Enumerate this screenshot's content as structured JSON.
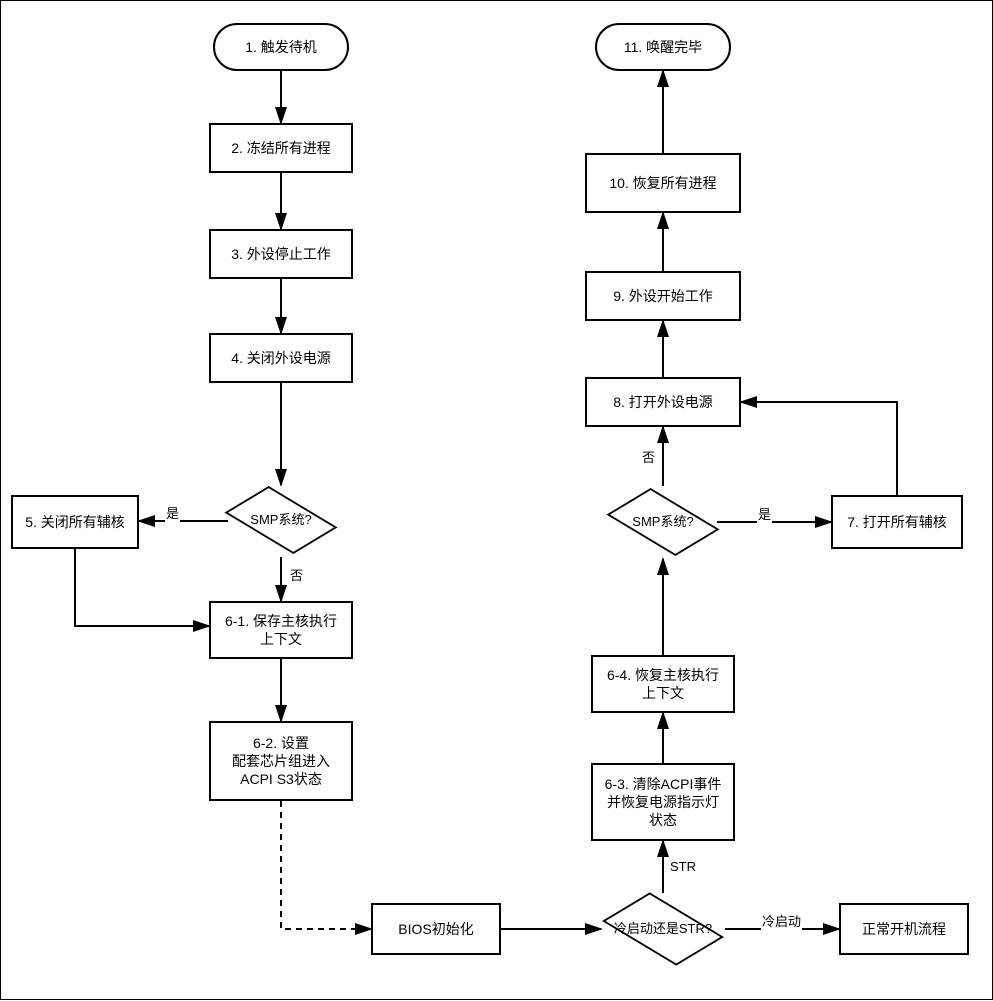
{
  "chart_data": {
    "type": "flowchart",
    "title": "",
    "nodes": [
      {
        "id": "n1",
        "label": "1. 触发待机",
        "shape": "terminator"
      },
      {
        "id": "n2",
        "label": "2. 冻结所有进程",
        "shape": "process"
      },
      {
        "id": "n3",
        "label": "3. 外设停止工作",
        "shape": "process"
      },
      {
        "id": "n4",
        "label": "4. 关闭外设电源",
        "shape": "process"
      },
      {
        "id": "d1",
        "label": "SMP系统?",
        "shape": "decision"
      },
      {
        "id": "n5",
        "label": "5. 关闭所有辅核",
        "shape": "process"
      },
      {
        "id": "n61",
        "label": "6-1. 保存主核执行上下文",
        "shape": "process"
      },
      {
        "id": "n62",
        "label": "6-2. 设置配套芯片组进入ACPI S3状态",
        "shape": "process"
      },
      {
        "id": "bios",
        "label": "BIOS初始化",
        "shape": "process"
      },
      {
        "id": "d2",
        "label": "冷启动还是STR?",
        "shape": "decision"
      },
      {
        "id": "nboot",
        "label": "正常开机流程",
        "shape": "process"
      },
      {
        "id": "n63",
        "label": "6-3. 清除ACPI事件并恢复电源指示灯状态",
        "shape": "process"
      },
      {
        "id": "n64",
        "label": "6-4. 恢复主核执行上下文",
        "shape": "process"
      },
      {
        "id": "d3",
        "label": "SMP系统?",
        "shape": "decision"
      },
      {
        "id": "n7",
        "label": "7. 打开所有辅核",
        "shape": "process"
      },
      {
        "id": "n8",
        "label": "8. 打开外设电源",
        "shape": "process"
      },
      {
        "id": "n9",
        "label": "9. 外设开始工作",
        "shape": "process"
      },
      {
        "id": "n10",
        "label": "10. 恢复所有进程",
        "shape": "process"
      },
      {
        "id": "n11",
        "label": "11. 唤醒完毕",
        "shape": "terminator"
      }
    ],
    "edges": [
      {
        "from": "n1",
        "to": "n2"
      },
      {
        "from": "n2",
        "to": "n3"
      },
      {
        "from": "n3",
        "to": "n4"
      },
      {
        "from": "n4",
        "to": "d1"
      },
      {
        "from": "d1",
        "to": "n5",
        "label": "是"
      },
      {
        "from": "d1",
        "to": "n61",
        "label": "否"
      },
      {
        "from": "n5",
        "to": "n61"
      },
      {
        "from": "n61",
        "to": "n62"
      },
      {
        "from": "n62",
        "to": "bios",
        "style": "dashed"
      },
      {
        "from": "bios",
        "to": "d2"
      },
      {
        "from": "d2",
        "to": "nboot",
        "label": "冷启动"
      },
      {
        "from": "d2",
        "to": "n63",
        "label": "STR"
      },
      {
        "from": "n63",
        "to": "n64"
      },
      {
        "from": "n64",
        "to": "d3"
      },
      {
        "from": "d3",
        "to": "n7",
        "label": "是"
      },
      {
        "from": "d3",
        "to": "n8",
        "label": "否"
      },
      {
        "from": "n7",
        "to": "n8"
      },
      {
        "from": "n8",
        "to": "n9"
      },
      {
        "from": "n9",
        "to": "n10"
      },
      {
        "from": "n10",
        "to": "n11"
      }
    ]
  },
  "labels": {
    "n1": "1. 触发待机",
    "n2": "2. 冻结所有进程",
    "n3": "3. 外设停止工作",
    "n4": "4. 关闭外设电源",
    "d1": "SMP系统?",
    "n5": "5. 关闭所有辅核",
    "n61": "6-1. 保存主核执行上下文",
    "n62": "6-2. 设置\n配套芯片组进入\nACPI S3状态",
    "bios": "BIOS初始化",
    "d2": "冷启动还是STR?",
    "nboot": "正常开机流程",
    "n63": "6-3. 清除ACPI事件并恢复电源指示灯状态",
    "n64": "6-4. 恢复主核执行上下文",
    "d3": "SMP系统?",
    "n7": "7. 打开所有辅核",
    "n8": "8. 打开外设电源",
    "n9": "9. 外设开始工作",
    "n10": "10. 恢复所有进程",
    "n11": "11. 唤醒完毕",
    "yes": "是",
    "no": "否",
    "str": "STR",
    "cold": "冷启动"
  }
}
